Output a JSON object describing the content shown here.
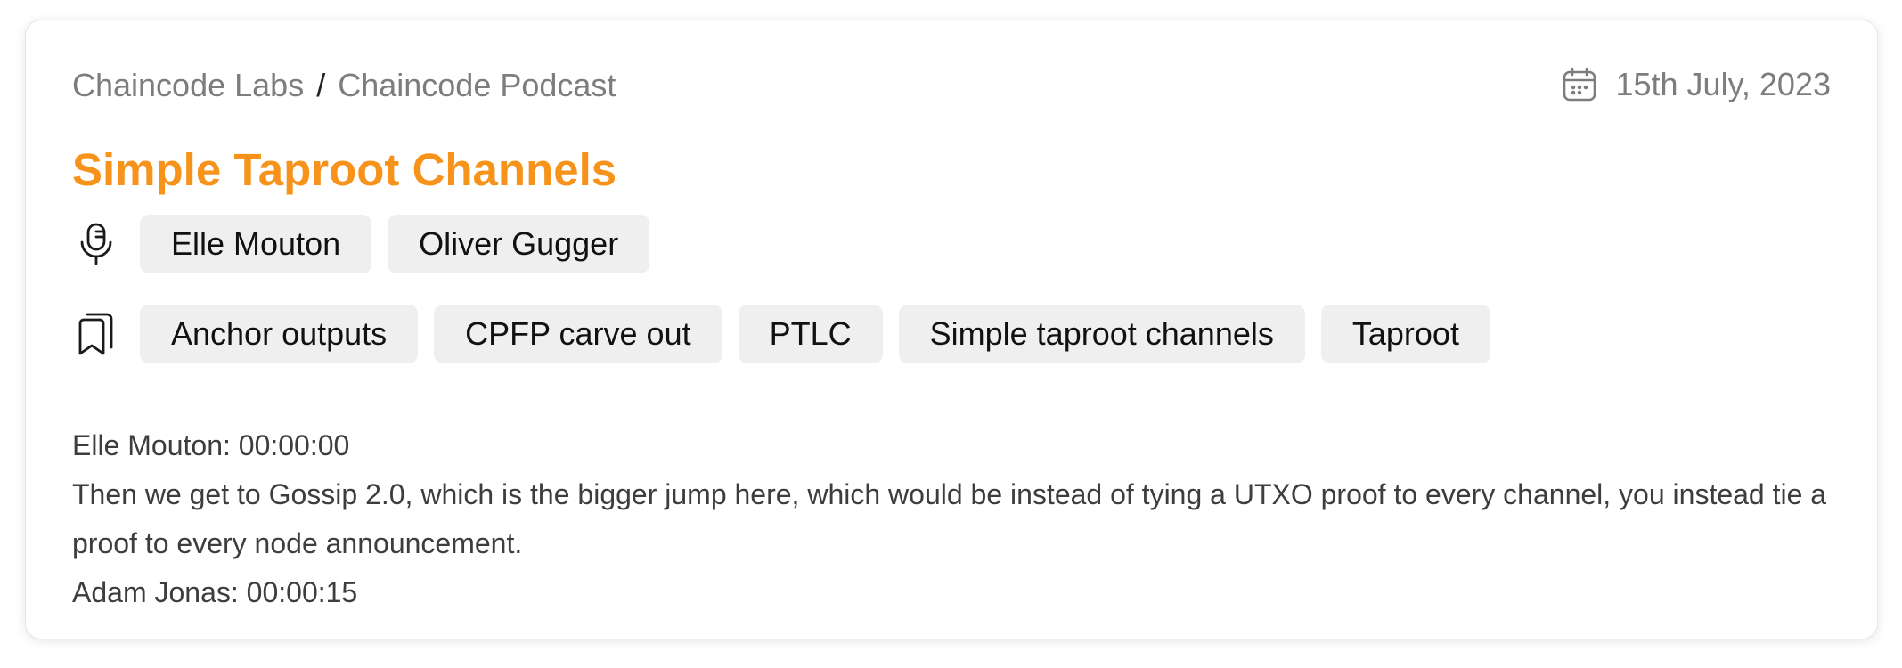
{
  "breadcrumb": {
    "source": "Chaincode Labs",
    "separator": "/",
    "series": "Chaincode Podcast"
  },
  "date": {
    "icon": "calendar-icon",
    "text": "15th July, 2023"
  },
  "title": "Simple Taproot Channels",
  "colors": {
    "title": "#f7931a",
    "chip_background": "#efefef",
    "muted_text": "#7d7d7d"
  },
  "speakers": {
    "icon": "microphone-icon",
    "items": [
      "Elle Mouton",
      "Oliver Gugger"
    ]
  },
  "tags": {
    "icon": "bookmarks-icon",
    "items": [
      "Anchor outputs",
      "CPFP carve out",
      "PTLC",
      "Simple taproot channels",
      "Taproot"
    ]
  },
  "transcript": {
    "line1": "Elle Mouton: 00:00:00",
    "line2": "Then we get to Gossip 2.0, which is the bigger jump here, which would be instead of tying a UTXO proof to every channel, you instead tie a proof to every node announcement.",
    "line3": "Adam Jonas: 00:00:15"
  }
}
